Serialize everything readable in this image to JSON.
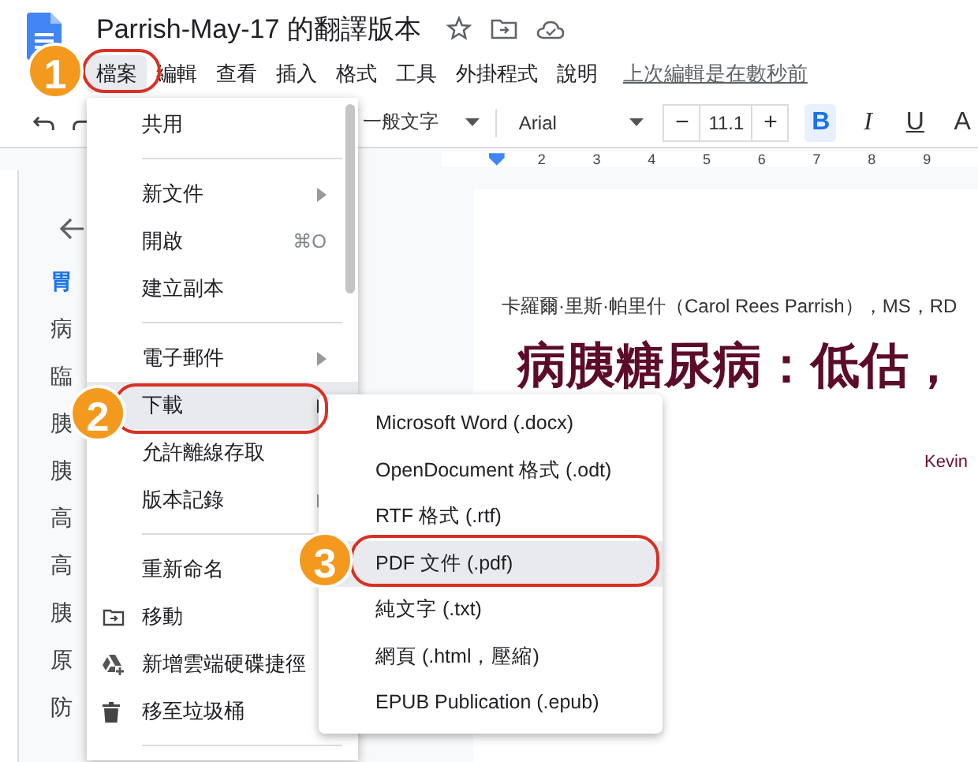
{
  "document_title": "Parrish-May-17 的翻譯版本",
  "menu_bar": [
    {
      "label": "檔案",
      "selected": true
    },
    {
      "label": "編輯",
      "selected": false
    },
    {
      "label": "查看",
      "selected": false
    },
    {
      "label": "插入",
      "selected": false
    },
    {
      "label": "格式",
      "selected": false
    },
    {
      "label": "工具",
      "selected": false
    },
    {
      "label": "外掛程式",
      "selected": false
    },
    {
      "label": "說明",
      "selected": false
    }
  ],
  "last_edit": "上次編輯是在數秒前",
  "toolbar": {
    "style": "一般文字",
    "font": "Arial",
    "font_size": "11.1",
    "decrease": "−",
    "increase": "+",
    "buttons": [
      {
        "label": "B",
        "kind": "bold",
        "selected": true
      },
      {
        "label": "I",
        "kind": "italic",
        "selected": false
      },
      {
        "label": "U",
        "kind": "underline",
        "selected": false
      },
      {
        "label": "A",
        "kind": "color",
        "selected": false
      }
    ]
  },
  "ruler": [
    "2",
    "3",
    "4",
    "5",
    "6",
    "7",
    "8",
    "9"
  ],
  "outline": {
    "items": [
      {
        "label": "胃",
        "selected": true
      },
      {
        "label": "病",
        "selected": false
      },
      {
        "label": "臨",
        "selected": false
      },
      {
        "label": "胰",
        "selected": false
      },
      {
        "label": "胰",
        "selected": false
      },
      {
        "label": "高",
        "selected": false
      },
      {
        "label": "高",
        "selected": false
      },
      {
        "label": "胰",
        "selected": false
      },
      {
        "label": "原",
        "selected": false
      },
      {
        "label": "防",
        "selected": false
      }
    ]
  },
  "document": {
    "byline": "卡羅爾·里斯·帕里什（Carol Rees Parrish），MS，RD",
    "heading": "病胰糖尿病：低估，",
    "author": "Kevin"
  },
  "file_menu": {
    "items": [
      {
        "kind": "item",
        "label": "共用",
        "selected": false
      },
      {
        "kind": "divider"
      },
      {
        "kind": "item",
        "label": "新文件",
        "submenu": true,
        "selected": false
      },
      {
        "kind": "item",
        "label": "開啟",
        "shortcut": "⌘O",
        "selected": false
      },
      {
        "kind": "item",
        "label": "建立副本",
        "selected": false
      },
      {
        "kind": "divider"
      },
      {
        "kind": "item",
        "label": "電子郵件",
        "submenu": true,
        "selected": false
      },
      {
        "kind": "item",
        "label": "下載",
        "submenu": true,
        "selected": true
      },
      {
        "kind": "item",
        "label": "允許離線存取",
        "selected": false
      },
      {
        "kind": "item",
        "label": "版本記錄",
        "submenu": true,
        "selected": false
      },
      {
        "kind": "divider"
      },
      {
        "kind": "item",
        "label": "重新命名",
        "selected": false
      },
      {
        "kind": "item",
        "label": "移動",
        "selected": false
      },
      {
        "kind": "item",
        "label": "新增雲端硬碟捷徑",
        "selected": false
      },
      {
        "kind": "item",
        "label": "移至垃圾桶",
        "selected": false
      },
      {
        "kind": "divider"
      }
    ]
  },
  "download_menu": {
    "items": [
      {
        "label": "Microsoft Word (.docx)",
        "selected": false
      },
      {
        "label": "OpenDocument 格式 (.odt)",
        "selected": false
      },
      {
        "label": "RTF 格式 (.rtf)",
        "selected": false
      },
      {
        "label": "PDF 文件 (.pdf)",
        "selected": true
      },
      {
        "label": "純文字 (.txt)",
        "selected": false
      },
      {
        "label": "網頁 (.html，壓縮)",
        "selected": false
      },
      {
        "label": "EPUB Publication (.epub)",
        "selected": false
      }
    ]
  },
  "annotations": [
    {
      "label": "1"
    },
    {
      "label": "2"
    },
    {
      "label": "3"
    }
  ]
}
